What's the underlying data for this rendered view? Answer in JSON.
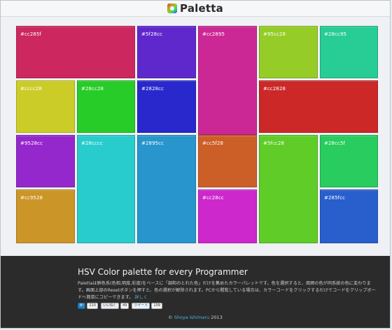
{
  "header": {
    "logo_text": "Paletta"
  },
  "tiles": [
    {
      "label": "#cc285f",
      "color": "#cc285f",
      "name": "color-tile-cc285f"
    },
    {
      "label": "#5f28cc",
      "color": "#5f28cc",
      "name": "color-tile-5f28cc"
    },
    {
      "label": "#cc2895",
      "color": "#cc2895",
      "name": "color-tile-cc2895"
    },
    {
      "label": "#95cc28",
      "color": "#95cc28",
      "name": "color-tile-95cc28"
    },
    {
      "label": "#28cc95",
      "color": "#28cc95",
      "name": "color-tile-28cc95"
    },
    {
      "label": "#cccc28",
      "color": "#cccc28",
      "name": "color-tile-cccc28"
    },
    {
      "label": "#28cc28",
      "color": "#28cc28",
      "name": "color-tile-28cc28"
    },
    {
      "label": "#2828cc",
      "color": "#2828cc",
      "name": "color-tile-2828cc"
    },
    {
      "label": "#cc2828",
      "color": "#cc2828",
      "name": "color-tile-cc2828"
    },
    {
      "label": "#9528cc",
      "color": "#9528cc",
      "name": "color-tile-9528cc"
    },
    {
      "label": "#28cccc",
      "color": "#28cccc",
      "name": "color-tile-28cccc"
    },
    {
      "label": "#2895cc",
      "color": "#2895cc",
      "name": "color-tile-2895cc"
    },
    {
      "label": "#cc5f28",
      "color": "#cc5f28",
      "name": "color-tile-cc5f28"
    },
    {
      "label": "#5fcc28",
      "color": "#5fcc28",
      "name": "color-tile-5fcc28"
    },
    {
      "label": "#28cc5f",
      "color": "#28cc5f",
      "name": "color-tile-28cc5f"
    },
    {
      "label": "#cc9528",
      "color": "#cc9528",
      "name": "color-tile-cc9528"
    },
    {
      "label": "#cc28cc",
      "color": "#cc28cc",
      "name": "color-tile-cc28cc"
    },
    {
      "label": "#285fcc",
      "color": "#285fcc",
      "name": "color-tile-285fcc"
    }
  ],
  "footer": {
    "title": "HSV Color palette for every Programmer",
    "description": "Palettaは鮮色系(色相,明度,彩度)をベースに「調和のとれた色」だけを集めたカラーパレットです。色を選択すると、周囲の色が同系統の色に変わります。画面上部のResetボタンを押すと、色の選択が解除されます。PCから閲覧している場合は、カラーコードをクリックするだけでコードをクリップボードへ簡単にコピーできます。",
    "more_link": "詳しく",
    "social": {
      "hatena_label": "B!",
      "hatena_count": "210",
      "like_label": "いいね！",
      "like_count": "49",
      "tweet_label": "ツイート",
      "tweet_count": "109"
    },
    "copyright_symbol": "©",
    "author": "Shoya Ishimaru",
    "year": "2013"
  }
}
